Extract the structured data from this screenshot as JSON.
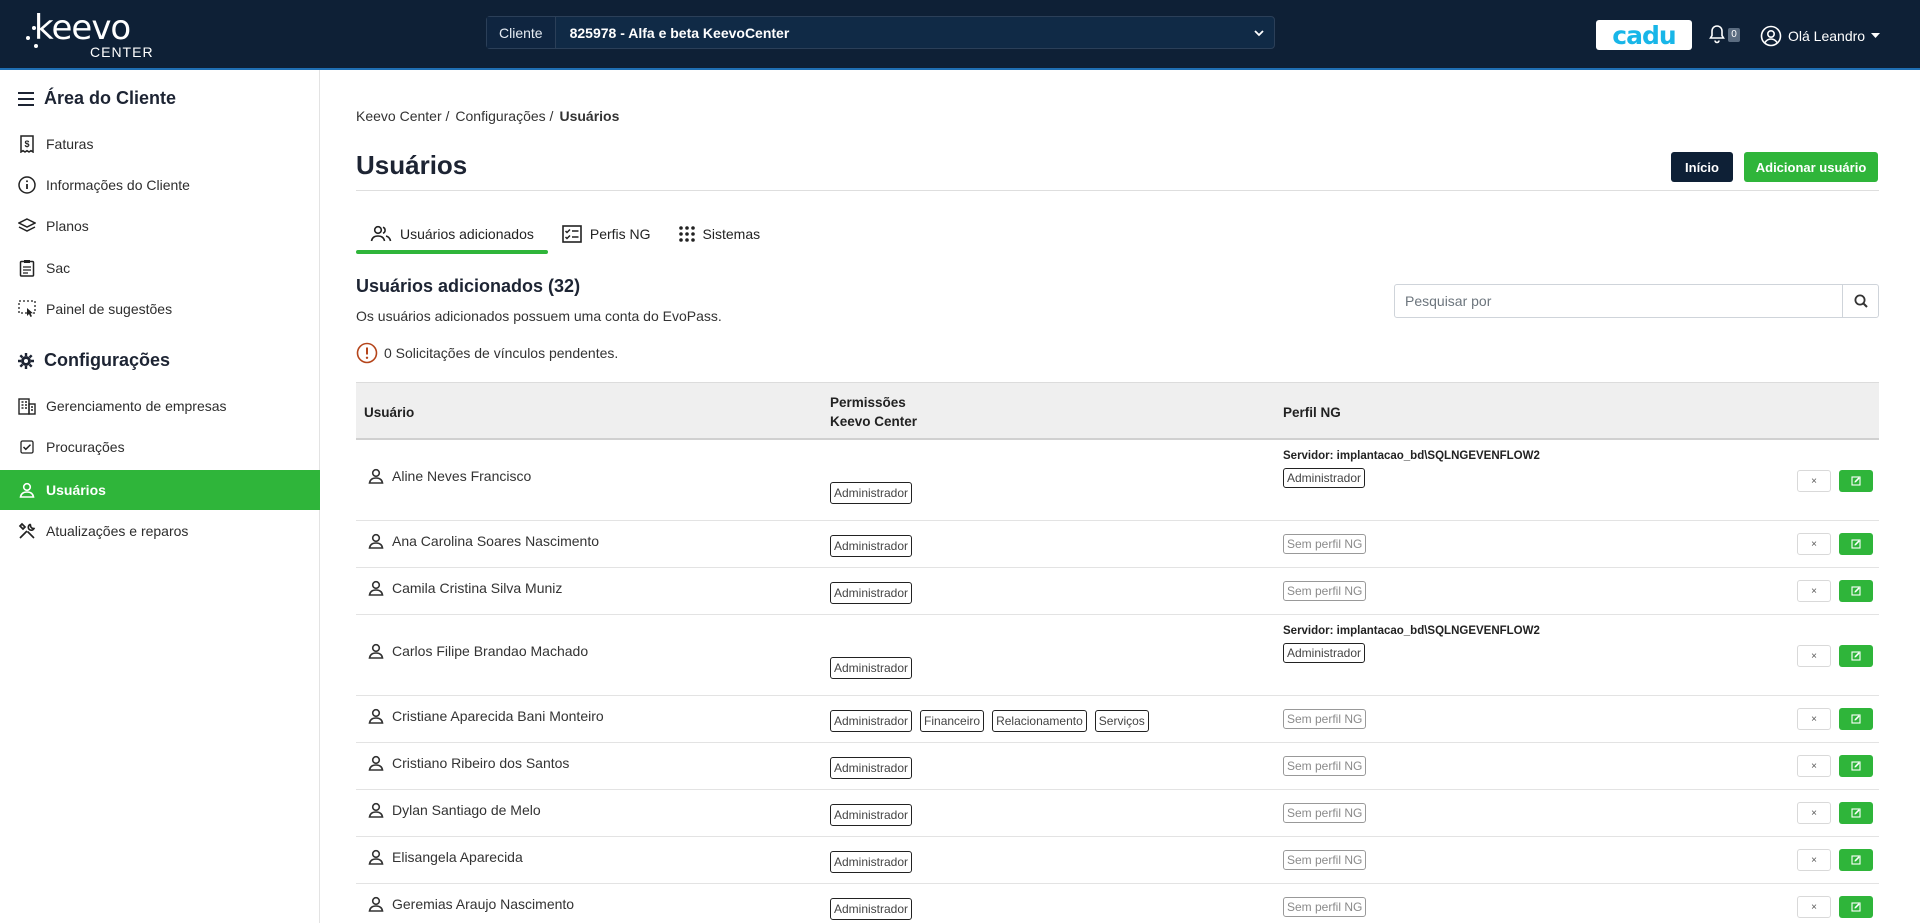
{
  "header": {
    "logo_text": "keevo",
    "logo_sub": "CENTER",
    "client_label": "Cliente",
    "client_value": "825978 - Alfa e beta KeevoCenter",
    "cadu_label": "cadu",
    "notifications_count": "0",
    "user_greeting": "Olá Leandro"
  },
  "sidebar": {
    "area_title": "Área do Cliente",
    "area_items": [
      {
        "label": "Faturas",
        "icon": "invoice-icon"
      },
      {
        "label": "Informações do Cliente",
        "icon": "info-icon"
      },
      {
        "label": "Planos",
        "icon": "layers-icon"
      },
      {
        "label": "Sac",
        "icon": "clipboard-icon"
      },
      {
        "label": "Painel de sugestões",
        "icon": "suggestion-icon"
      }
    ],
    "config_title": "Configurações",
    "config_items": [
      {
        "label": "Gerenciamento de empresas",
        "icon": "building-icon"
      },
      {
        "label": "Procurações",
        "icon": "check-square-icon"
      },
      {
        "label": "Usuários",
        "icon": "user-icon",
        "active": true
      },
      {
        "label": "Atualizações e reparos",
        "icon": "tools-icon"
      }
    ]
  },
  "breadcrumb": [
    "Keevo Center /",
    "Configurações /",
    "Usuários"
  ],
  "page_title": "Usuários",
  "buttons": {
    "inicio": "Início",
    "add_user": "Adicionar usuário"
  },
  "tabs": [
    {
      "label": "Usuários adicionados",
      "active": true
    },
    {
      "label": "Perfis NG"
    },
    {
      "label": "Sistemas"
    }
  ],
  "section": {
    "title": "Usuários adicionados (32)",
    "subtitle": "Os usuários adicionados possuem uma conta do EvoPass.",
    "pending": "0 Solicitações de vínculos pendentes."
  },
  "search": {
    "placeholder": "Pesquisar por"
  },
  "table": {
    "headers": {
      "user": "Usuário",
      "perm_line1": "Permissões",
      "perm_line2": "Keevo Center",
      "ng": "Perfil NG"
    },
    "rows": [
      {
        "name": "Aline Neves Francisco",
        "perms": [
          "Administrador"
        ],
        "server": "Servidor: implantacao_bd\\SQLNGEVENFLOW2",
        "ng": "Administrador"
      },
      {
        "name": "Ana Carolina Soares Nascimento",
        "perms": [
          "Administrador"
        ],
        "server": "",
        "ng": "Sem perfil NG"
      },
      {
        "name": "Camila Cristina Silva Muniz",
        "perms": [
          "Administrador"
        ],
        "server": "",
        "ng": "Sem perfil NG"
      },
      {
        "name": "Carlos Filipe Brandao Machado",
        "perms": [
          "Administrador"
        ],
        "server": "Servidor: implantacao_bd\\SQLNGEVENFLOW2",
        "ng": "Administrador"
      },
      {
        "name": "Cristiane Aparecida Bani Monteiro",
        "perms": [
          "Administrador",
          "Financeiro",
          "Relacionamento",
          "Serviços"
        ],
        "server": "",
        "ng": "Sem perfil NG"
      },
      {
        "name": "Cristiano Ribeiro dos Santos",
        "perms": [
          "Administrador"
        ],
        "server": "",
        "ng": "Sem perfil NG"
      },
      {
        "name": "Dylan Santiago de Melo",
        "perms": [
          "Administrador"
        ],
        "server": "",
        "ng": "Sem perfil NG"
      },
      {
        "name": "Elisangela Aparecida",
        "perms": [
          "Administrador"
        ],
        "server": "",
        "ng": "Sem perfil NG"
      },
      {
        "name": "Geremias Araujo Nascimento",
        "perms": [
          "Administrador"
        ],
        "server": "",
        "ng": "Sem perfil NG"
      }
    ],
    "remove_symbol": "×"
  },
  "colors": {
    "navy": "#0e2036",
    "green": "#2fb53a",
    "cadu": "#18b6e8"
  }
}
